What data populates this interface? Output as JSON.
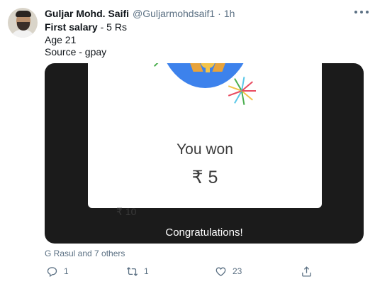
{
  "author": {
    "name": "Guljar Mohd. Saifi",
    "handle": "@Guljarmohdsaif1",
    "separator": "·",
    "time": "1h"
  },
  "tweet": {
    "line1_bold": "First salary",
    "line1_rest": " - 5 Rs",
    "line2": "Age 21",
    "line3": "Source - gpay"
  },
  "media": {
    "headline": "You won",
    "amount": "₹ 5",
    "background_amount": "₹ 10",
    "footer": "Congratulations!"
  },
  "social_context": "G Rasul and 7 others",
  "actions": {
    "reply_count": "1",
    "retweet_count": "1",
    "like_count": "23"
  },
  "icons": {
    "reply": "reply-icon",
    "retweet": "retweet-icon",
    "like": "heart-icon",
    "share": "share-icon",
    "more": "more-icon"
  },
  "colors": {
    "secondary_text": "#5b7083",
    "globe_blue": "#3d82ec",
    "trophy_gold": "#f3c44a",
    "media_background": "#1b1b1b"
  }
}
